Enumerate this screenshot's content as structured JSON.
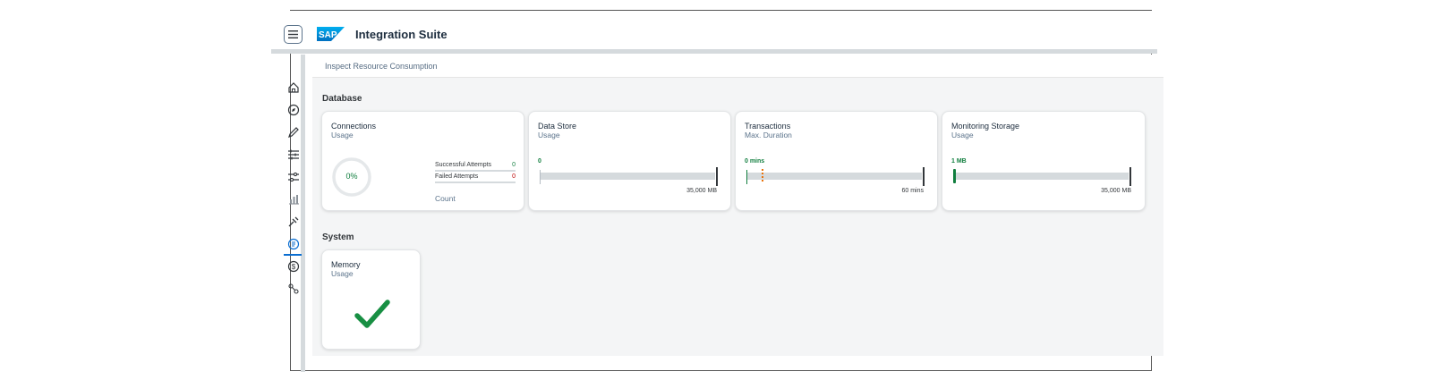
{
  "shell": {
    "menu_icon": "hamburger-menu-icon",
    "logo_text": "SAP",
    "title": "Integration Suite",
    "brand_color": "#0a6ed1"
  },
  "nav": {
    "items": [
      {
        "icon": "home-icon"
      },
      {
        "icon": "discover-icon"
      },
      {
        "icon": "design-pencil-icon"
      },
      {
        "icon": "configure-list-icon"
      },
      {
        "icon": "monitor-sliders-icon"
      },
      {
        "icon": "analytics-bar-icon"
      },
      {
        "icon": "test-tool-icon"
      },
      {
        "icon": "inspect-icon",
        "active": true
      },
      {
        "icon": "dollar-icon"
      },
      {
        "icon": "settings-nodes-icon"
      }
    ]
  },
  "breadcrumb": "Inspect Resource Consumption",
  "database": {
    "title": "Database",
    "connections": {
      "title": "Connections",
      "subtitle": "Usage",
      "percent_label": "0%",
      "percent_value": 0,
      "successful_label": "Successful Attempts",
      "successful_value": "0",
      "failed_label": "Failed Attempts",
      "failed_value": "0",
      "count_label": "Count"
    },
    "data_store": {
      "title": "Data Store",
      "subtitle": "Usage",
      "value_label": "0",
      "max_label": "35,000 MB",
      "fraction": 0
    },
    "transactions": {
      "title": "Transactions",
      "subtitle": "Max. Duration",
      "value_label": "0 mins",
      "max_label": "60 mins",
      "fraction": 0
    },
    "monitoring_storage": {
      "title": "Monitoring Storage",
      "subtitle": "Usage",
      "value_label": "1 MB",
      "max_label": "35,000 MB",
      "fraction": 3e-05
    }
  },
  "system": {
    "title": "System",
    "memory": {
      "title": "Memory",
      "subtitle": "Usage",
      "status_icon": "checkmark-icon"
    }
  },
  "colors": {
    "good": "#107e3e",
    "critical": "#e9730c",
    "error": "#bb0000",
    "track": "#d5dadd"
  }
}
